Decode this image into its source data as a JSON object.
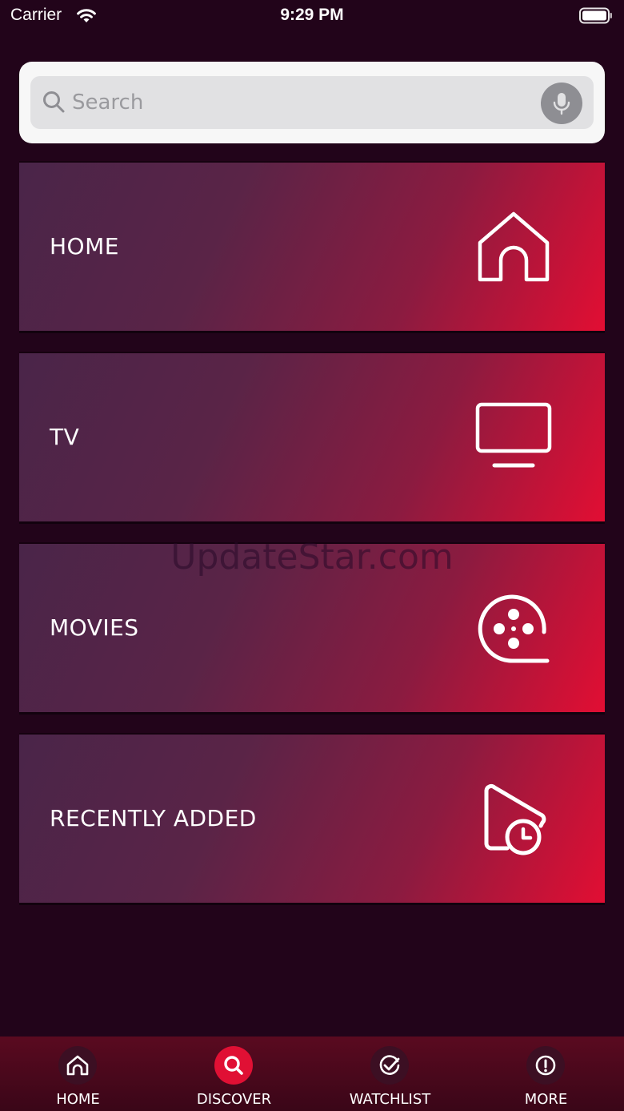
{
  "status_bar": {
    "carrier": "Carrier",
    "time": "9:29 PM"
  },
  "search": {
    "placeholder": "Search",
    "value": ""
  },
  "categories": [
    {
      "label": "HOME",
      "icon": "house-icon"
    },
    {
      "label": "TV",
      "icon": "tv-icon"
    },
    {
      "label": "MOVIES",
      "icon": "film-reel-icon"
    },
    {
      "label": "RECENTLY ADDED",
      "icon": "folder-clock-icon"
    }
  ],
  "watermark": "UpdateStar.com",
  "tab_bar": {
    "active": "DISCOVER",
    "tabs": [
      {
        "label": "HOME",
        "icon": "house-icon"
      },
      {
        "label": "DISCOVER",
        "icon": "search-icon"
      },
      {
        "label": "WATCHLIST",
        "icon": "check-icon"
      },
      {
        "label": "MORE",
        "icon": "info-icon"
      }
    ]
  },
  "colors": {
    "background": "#22041a",
    "accent": "#e01034",
    "card_gradient_start": "#4a2549",
    "card_gradient_end": "#e20e33"
  }
}
